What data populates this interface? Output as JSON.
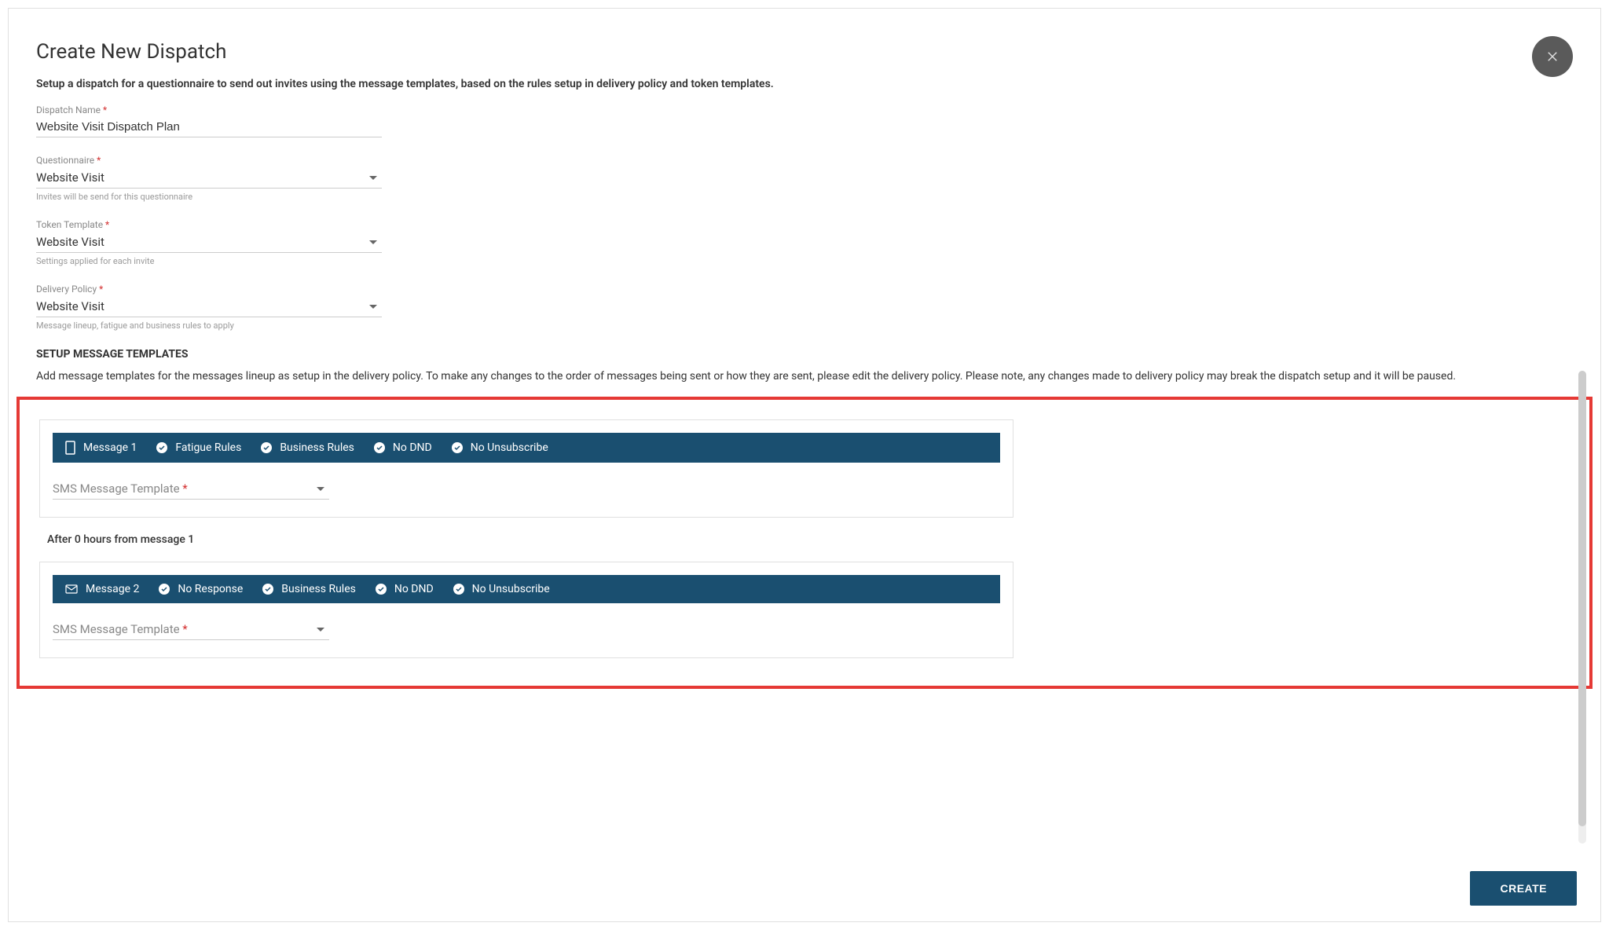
{
  "header": {
    "title": "Create New Dispatch",
    "description": "Setup a dispatch for a questionnaire to send out invites using the message templates, based on the rules setup in delivery policy and token templates."
  },
  "fields": {
    "dispatchName": {
      "label": "Dispatch Name",
      "value": "Website Visit Dispatch Plan"
    },
    "questionnaire": {
      "label": "Questionnaire",
      "value": "Website Visit",
      "hint": "Invites will be send for this questionnaire"
    },
    "tokenTemplate": {
      "label": "Token Template",
      "value": "Website Visit",
      "hint": "Settings applied for each invite"
    },
    "deliveryPolicy": {
      "label": "Delivery Policy",
      "value": "Website Visit",
      "hint": "Message lineup, fatigue and business rules to apply"
    }
  },
  "templatesSection": {
    "heading": "SETUP MESSAGE TEMPLATES",
    "description": "Add message templates for the messages lineup as setup in the delivery policy. To make any changes to the order of messages being sent or how they are sent, please edit the delivery policy. Please note, any changes made to delivery policy may break the dispatch setup and it will be paused."
  },
  "messages": [
    {
      "title": "Message 1",
      "iconType": "sms",
      "tags": [
        "Fatigue Rules",
        "Business Rules",
        "No DND",
        "No Unsubscribe"
      ],
      "templatePlaceholder": "SMS Message Template"
    },
    {
      "title": "Message 2",
      "iconType": "email",
      "tags": [
        "No Response",
        "Business Rules",
        "No DND",
        "No Unsubscribe"
      ],
      "templatePlaceholder": "SMS Message Template"
    }
  ],
  "intervalText": "After 0 hours from message 1",
  "footer": {
    "createButton": "CREATE"
  }
}
